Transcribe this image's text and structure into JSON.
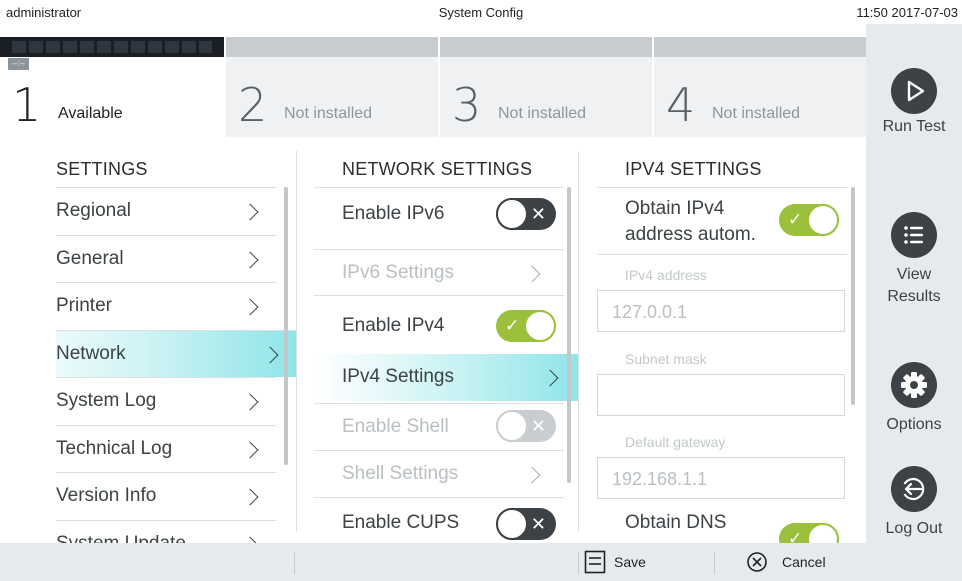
{
  "topbar": {
    "user": "administrator",
    "title": "System Config",
    "clock": "11:50 2017-07-03"
  },
  "modules": [
    {
      "number": "1",
      "label": "Available",
      "tag": "--:--"
    },
    {
      "number": "2",
      "label": "Not installed"
    },
    {
      "number": "3",
      "label": "Not installed"
    },
    {
      "number": "4",
      "label": "Not installed"
    }
  ],
  "actions": {
    "run_test": "Run Test",
    "view_results_1": "View",
    "view_results_2": "Results",
    "options": "Options",
    "log_out": "Log Out"
  },
  "settings": {
    "heading": "SETTINGS",
    "items": [
      "Regional",
      "General",
      "Printer",
      "Network",
      "System Log",
      "Technical Log",
      "Version Info",
      "System Update"
    ],
    "selected": "Network"
  },
  "network": {
    "heading": "NETWORK SETTINGS",
    "items": [
      {
        "label": "Enable IPv6",
        "type": "toggle",
        "state": "off"
      },
      {
        "label": "IPv6 Settings",
        "type": "link",
        "disabled": true
      },
      {
        "label": "Enable IPv4",
        "type": "toggle",
        "state": "on"
      },
      {
        "label": "IPv4 Settings",
        "type": "link",
        "selected": true
      },
      {
        "label": "Enable Shell",
        "type": "toggle",
        "state": "off",
        "disabled": true
      },
      {
        "label": "Shell Settings",
        "type": "link",
        "disabled": true
      },
      {
        "label": "Enable CUPS",
        "type": "toggle",
        "state": "off"
      }
    ]
  },
  "ipv4": {
    "heading": "IPV4 SETTINGS",
    "obtain_auto_line1": "Obtain IPv4",
    "obtain_auto_line2": "address autom.",
    "address_label": "IPv4 address",
    "address_value": "127.0.0.1",
    "subnet_label": "Subnet mask",
    "subnet_value": "",
    "gateway_label": "Default gateway",
    "gateway_value": "192.168.1.1",
    "obtain_dns": "Obtain DNS"
  },
  "bottombar": {
    "save": "Save",
    "cancel": "Cancel"
  },
  "colors": {
    "toggle_on": "#9bc03b",
    "toggle_off": "#3c4245",
    "selection": "#8ee5e8"
  }
}
